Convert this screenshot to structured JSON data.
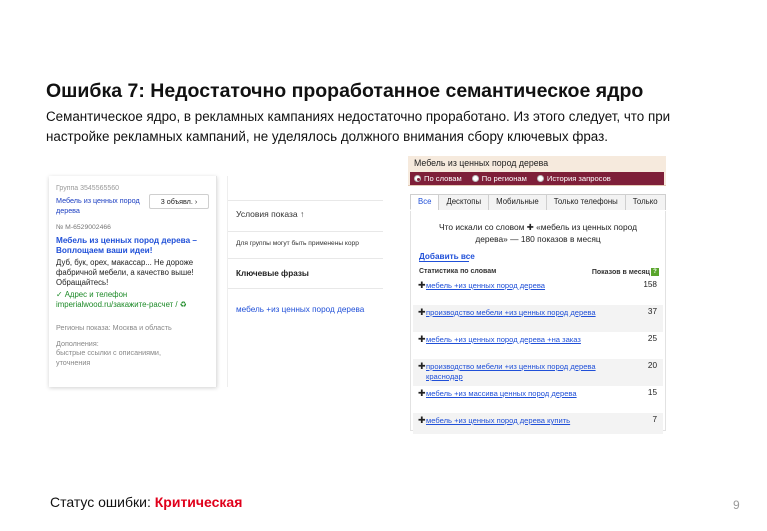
{
  "slide": {
    "title": "Ошибка 7: Недостаточно проработанное семантическое ядро",
    "subtitle": "Семантическое ядро, в рекламных кампаниях недостаточно проработано. Из этого следует, что при настройке рекламных кампаний, не уделялось должного внимания сбору ключевых фраз.",
    "status_label": "Статус ошибки:",
    "status_value": "Критическая",
    "page_number": "9"
  },
  "direct": {
    "group": "Группа 3545565560",
    "phrase": "Мебель из ценных пород дерева",
    "ads_button": "3 объявл.",
    "ad_number": "№ М-6529002466",
    "headline": "Мебель из ценных пород дерева – Воплощаем ваши идеи!",
    "text": "Дуб, бук, орех, макассар... Не дороже фабричной мебели, а качество выше! Обращайтесь!",
    "link_address": "Адрес и телефон",
    "link_site": "imperialwood.ru/закажите-расчет",
    "regions": "Регионы показа: Москва и область",
    "extra_label": "Дополнения:",
    "extra_text": "быстрые ссылки с описаниями, уточнения",
    "conditions_title": "Условия показа",
    "conditions_note": "Для группы могут быть применены корр",
    "keywords_label": "Ключевые фразы",
    "keyword": "мебель +из ценных пород дерева"
  },
  "wordstat": {
    "title": "Мебель из ценных пород дерева",
    "modes": [
      {
        "label": "По словам",
        "selected": true
      },
      {
        "label": "По регионам",
        "selected": false
      },
      {
        "label": "История запросов",
        "selected": false
      }
    ],
    "tabs": [
      "Все",
      "Десктопы",
      "Мобильные",
      "Только телефоны",
      "Только"
    ],
    "active_tab": "Все",
    "query_line": "Что искали со словом ✚ «мебель из ценных пород дерева» — 180 показов в месяц",
    "add_all": "Добавить все",
    "col_phrase": "Статистика по словам",
    "col_count": "Показов в месяц",
    "help_icon": "?",
    "rows": [
      {
        "phrase": "мебель +из ценных пород дерева",
        "count": "158"
      },
      {
        "phrase": "производство мебели +из ценных пород дерева",
        "count": "37"
      },
      {
        "phrase": "мебель +из ценных пород дерева +на заказ",
        "count": "25"
      },
      {
        "phrase": "производство мебели +из ценных пород дерева краснодар",
        "count": "20"
      },
      {
        "phrase": "мебель +из массива ценных пород дерева",
        "count": "15"
      },
      {
        "phrase": "мебель +из ценных пород дерева купить",
        "count": "7"
      }
    ]
  },
  "colors": {
    "accent_red": "#e0001b",
    "wordstat_bar": "#7e1f39",
    "link_blue": "#2050d8",
    "link_green": "#1c8a27"
  }
}
